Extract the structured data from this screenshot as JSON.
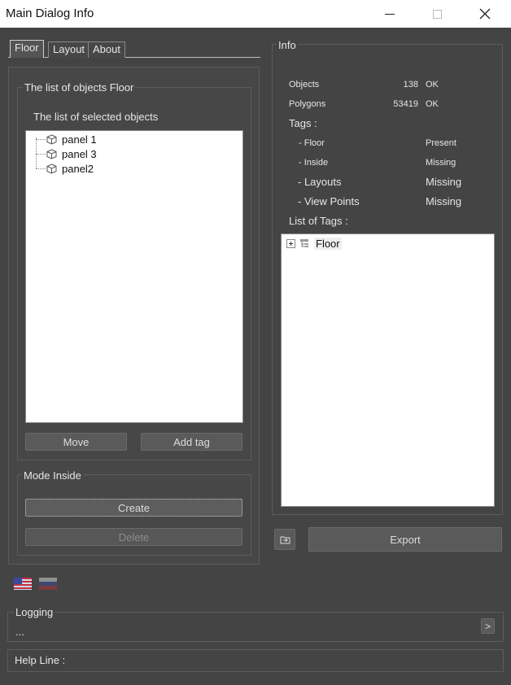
{
  "window": {
    "title": "Main Dialog Info"
  },
  "tabs": [
    {
      "label": "Floor",
      "active": true
    },
    {
      "label": "Layout",
      "active": false
    },
    {
      "label": "About",
      "active": false
    }
  ],
  "floor_panel": {
    "group_title": "The list of objects Floor",
    "list_title": "The list of selected objects",
    "items": [
      "panel 1",
      "panel 3",
      "panel2"
    ],
    "move_label": "Move",
    "add_tag_label": "Add tag"
  },
  "mode_inside": {
    "group_title": "Mode Inside",
    "create_label": "Create",
    "delete_label": "Delete"
  },
  "info": {
    "group_title": "Info",
    "objects_label": "Objects",
    "objects_count": "138",
    "objects_status": "OK",
    "polygons_label": "Polygons",
    "polygons_count": "53419",
    "polygons_status": "OK",
    "tags_label": "Tags :",
    "tag_rows": [
      {
        "name": "- Floor",
        "status": "Present"
      },
      {
        "name": "- Inside",
        "status": "Missing"
      },
      {
        "name": "- Layouts",
        "status": "Missing"
      },
      {
        "name": "- View Points",
        "status": "Missing"
      }
    ],
    "list_of_tags_label": "List of Tags :",
    "tag_tree": [
      {
        "label": "Floor"
      }
    ],
    "export_label": "Export"
  },
  "logging": {
    "title": "Logging",
    "text": "...",
    "expand_label": ">"
  },
  "help_line": {
    "label": "Help Line :"
  },
  "colors": {
    "background": "#444444",
    "panel": "#474747",
    "button": "#5a5a5a",
    "text": "#e6e6e6"
  },
  "icons": {
    "tree_item": "cube-icon",
    "tag_tree_expand": "plus-box-icon",
    "tag_tree_node": "hierarchy-icon",
    "folder_button": "folder-icon",
    "language_flags": [
      "us-flag-icon",
      "ru-flag-icon"
    ]
  }
}
